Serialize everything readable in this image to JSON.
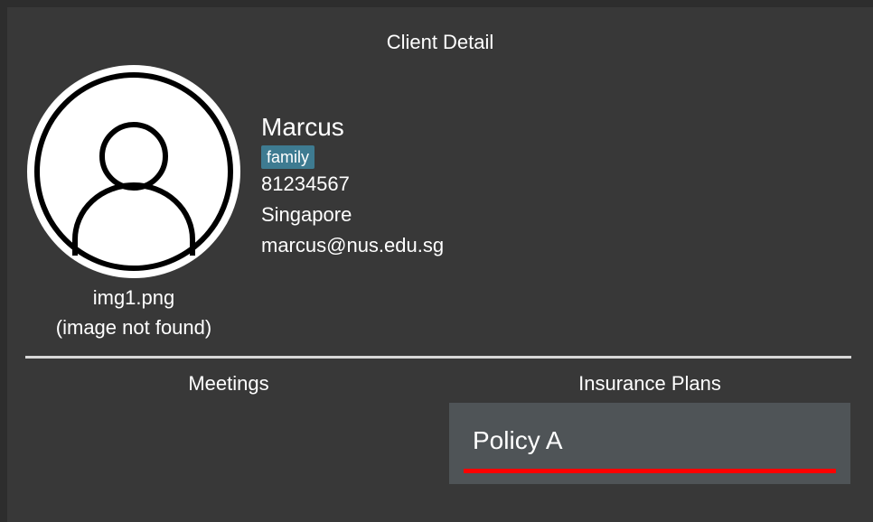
{
  "panel": {
    "title": "Client Detail"
  },
  "client": {
    "name": "Marcus",
    "tag": "family",
    "phone": "81234567",
    "address": "Singapore",
    "email": "marcus@nus.edu.sg",
    "image_filename": "img1.png",
    "image_status": "(image not found)",
    "avatar_icon": "person-icon"
  },
  "sections": {
    "meetings_title": "Meetings",
    "insurance_title": "Insurance Plans"
  },
  "insurance_plans": [
    {
      "name": "Policy A",
      "accent_color": "#ff0000"
    }
  ],
  "colors": {
    "background": "#383838",
    "tag_background": "#3e7b91",
    "plan_card_background": "#4f5457",
    "divider": "#d8d8d8"
  }
}
